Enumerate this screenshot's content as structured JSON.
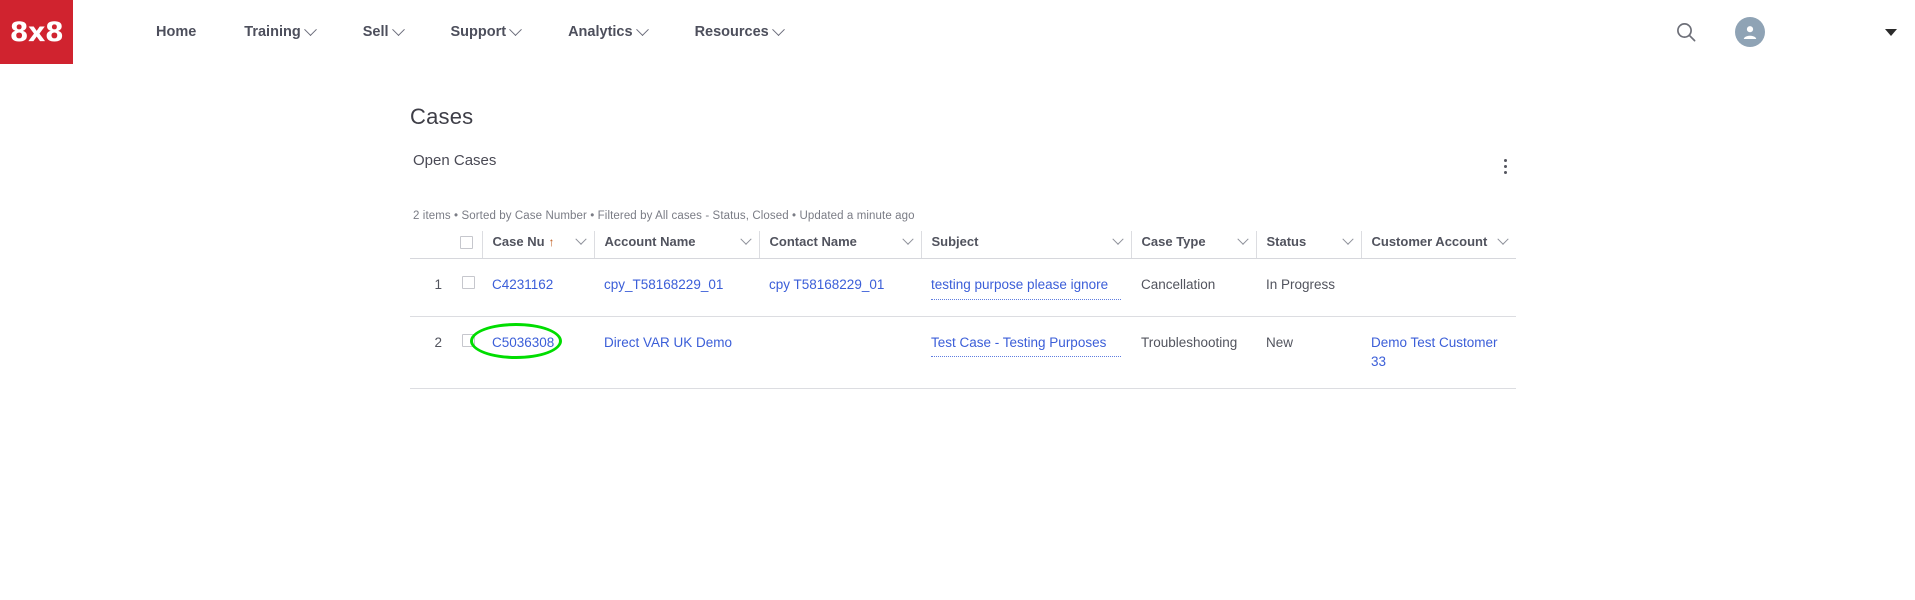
{
  "header": {
    "logo_text": "8x8",
    "nav_items": [
      {
        "label": "Home",
        "has_chevron": false
      },
      {
        "label": "Training",
        "has_chevron": true
      },
      {
        "label": "Sell",
        "has_chevron": true
      },
      {
        "label": "Support",
        "has_chevron": true
      },
      {
        "label": "Analytics",
        "has_chevron": true
      },
      {
        "label": "Resources",
        "has_chevron": true
      }
    ],
    "icons": {
      "search": "search-icon",
      "avatar": "user-avatar-icon",
      "caret": "chevron-down-icon"
    },
    "brand_color": "#D0232F"
  },
  "main": {
    "page_title": "Cases",
    "list_view_name": "Open Cases",
    "meta_line": "2 items • Sorted by Case Number • Filtered by All cases - Status, Closed • Updated a minute ago",
    "columns": [
      {
        "label": "Case Nu",
        "sorted": "ascending",
        "sort_glyph": "↑"
      },
      {
        "label": "Account Name",
        "sorted": ""
      },
      {
        "label": "Contact Name",
        "sorted": ""
      },
      {
        "label": "Subject",
        "sorted": ""
      },
      {
        "label": "Case Type",
        "sorted": ""
      },
      {
        "label": "Status",
        "sorted": ""
      },
      {
        "label": "Customer Account",
        "sorted": ""
      }
    ],
    "rows": [
      {
        "number": "1",
        "case_number": "C4231162",
        "account_name": "cpy_T58168229_01",
        "contact_name": "cpy T58168229_01",
        "subject": "testing purpose please ignore",
        "case_type": "Cancellation",
        "status": "In Progress",
        "customer_account": "",
        "highlighted": false
      },
      {
        "number": "2",
        "case_number": "C5036308",
        "account_name": "Direct VAR UK Demo",
        "contact_name": "",
        "subject": "Test Case - Testing Purposes",
        "case_type": "Troubleshooting",
        "status": "New",
        "customer_account": "Demo Test Customer 33",
        "highlighted": true
      }
    ]
  },
  "annotation": {
    "type": "ellipse",
    "color": "#00dd00",
    "target": "C5036308"
  }
}
